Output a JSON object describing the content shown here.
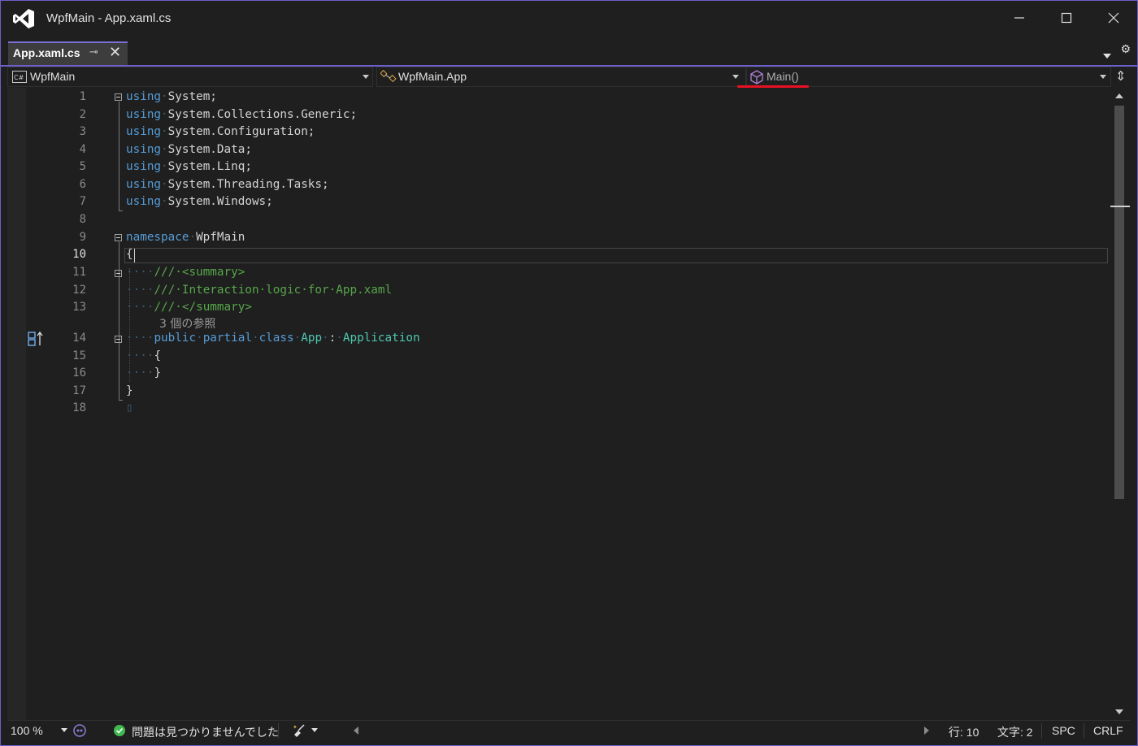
{
  "window": {
    "title": "WpfMain - App.xaml.cs"
  },
  "tabs": [
    {
      "label": "App.xaml.cs",
      "active": true
    }
  ],
  "navbar": {
    "project": "WpfMain",
    "type": "WpfMain.App",
    "member": "Main()"
  },
  "editor": {
    "line_numbers": [
      "1",
      "2",
      "3",
      "4",
      "5",
      "6",
      "7",
      "8",
      "9",
      "10",
      "11",
      "12",
      "13",
      "14",
      "15",
      "16",
      "17",
      "18"
    ],
    "current_line": "10",
    "codelens": "3 個の参照",
    "lines": [
      {
        "tokens": [
          [
            "kw",
            "using"
          ],
          [
            "ws",
            "·"
          ],
          [
            "plain",
            "System;"
          ]
        ]
      },
      {
        "tokens": [
          [
            "kw",
            "using"
          ],
          [
            "ws",
            "·"
          ],
          [
            "plain",
            "System.Collections.Generic;"
          ]
        ]
      },
      {
        "tokens": [
          [
            "kw",
            "using"
          ],
          [
            "ws",
            "·"
          ],
          [
            "plain",
            "System.Configuration;"
          ]
        ]
      },
      {
        "tokens": [
          [
            "kw",
            "using"
          ],
          [
            "ws",
            "·"
          ],
          [
            "plain",
            "System.Data;"
          ]
        ]
      },
      {
        "tokens": [
          [
            "kw",
            "using"
          ],
          [
            "ws",
            "·"
          ],
          [
            "plain",
            "System.Linq;"
          ]
        ]
      },
      {
        "tokens": [
          [
            "kw",
            "using"
          ],
          [
            "ws",
            "·"
          ],
          [
            "plain",
            "System.Threading.Tasks;"
          ]
        ]
      },
      {
        "tokens": [
          [
            "kw",
            "using"
          ],
          [
            "ws",
            "·"
          ],
          [
            "plain",
            "System.Windows;"
          ]
        ]
      },
      {
        "tokens": []
      },
      {
        "tokens": [
          [
            "kw",
            "namespace"
          ],
          [
            "ws",
            "·"
          ],
          [
            "plain",
            "WpfMain"
          ]
        ]
      },
      {
        "tokens": [
          [
            "plain",
            "{"
          ]
        ]
      },
      {
        "tokens": [
          [
            "ws",
            "····"
          ],
          [
            "cmt",
            "///·<summary>"
          ]
        ]
      },
      {
        "tokens": [
          [
            "ws",
            "····"
          ],
          [
            "cmt",
            "///·Interaction·logic·for·App.xaml"
          ]
        ]
      },
      {
        "tokens": [
          [
            "ws",
            "····"
          ],
          [
            "cmt",
            "///·</summary>"
          ]
        ]
      },
      {
        "tokens": [
          [
            "ws",
            "····"
          ],
          [
            "kw",
            "public"
          ],
          [
            "ws",
            "·"
          ],
          [
            "kw",
            "partial"
          ],
          [
            "ws",
            "·"
          ],
          [
            "kw",
            "class"
          ],
          [
            "ws",
            "·"
          ],
          [
            "typ",
            "App"
          ],
          [
            "ws",
            "·"
          ],
          [
            "plain",
            ":"
          ],
          [
            "ws",
            "·"
          ],
          [
            "typ",
            "Application"
          ]
        ]
      },
      {
        "tokens": [
          [
            "ws",
            "····"
          ],
          [
            "plain",
            "{"
          ]
        ]
      },
      {
        "tokens": [
          [
            "ws",
            "····"
          ],
          [
            "plain",
            "}"
          ]
        ]
      },
      {
        "tokens": [
          [
            "plain",
            "}"
          ]
        ]
      },
      {
        "tokens": [
          [
            "ws",
            "▯"
          ]
        ]
      }
    ]
  },
  "statusbar": {
    "zoom": "100 %",
    "issues": "問題は見つかりませんでした",
    "line": "行: 10",
    "column": "文字: 2",
    "whitespace": "SPC",
    "line_ending": "CRLF"
  }
}
